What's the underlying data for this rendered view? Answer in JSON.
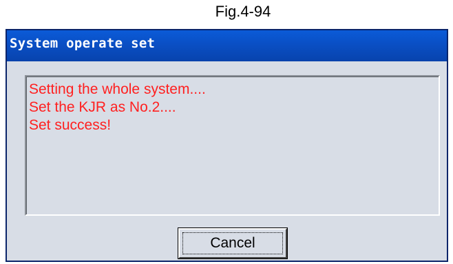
{
  "caption": "Fig.4-94",
  "dialog": {
    "title": "System operate set",
    "messages": [
      "Setting the whole system....",
      "Set the KJR as No.2....",
      "Set success!"
    ],
    "cancel_label": "Cancel"
  },
  "colors": {
    "titlebar": "#0a4fc4",
    "message_text": "#ff2020",
    "dialog_background": "#d8dde6"
  }
}
